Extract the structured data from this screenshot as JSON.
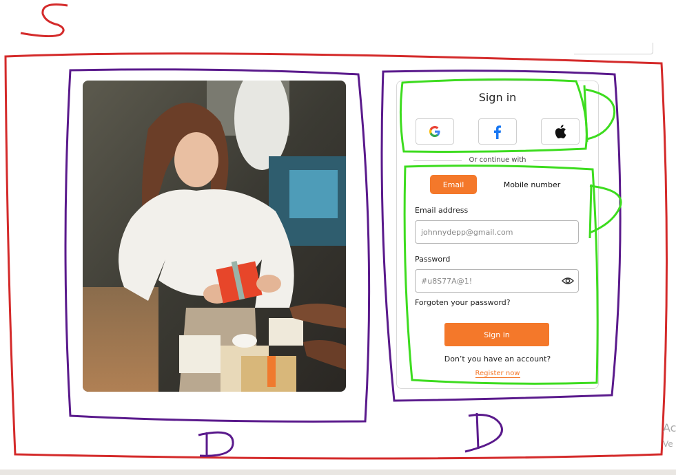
{
  "signin": {
    "title": "Sign in",
    "social": [
      {
        "name": "google-icon"
      },
      {
        "name": "facebook-icon"
      },
      {
        "name": "apple-icon"
      }
    ],
    "divider": "Or continue with",
    "tabs": [
      "Email",
      "Mobile number"
    ],
    "email_label": "Email address",
    "email_placeholder": "johnnydepp@gmail.com",
    "password_label": "Password",
    "password_placeholder": "#u8S77A@1!",
    "forgot": "Forgoten your password?",
    "button": "Sign in",
    "no_account": "Don’t you have an account?",
    "register": "Register now"
  },
  "annotations": {
    "s": "S",
    "d_left": "D",
    "d_right": "D"
  },
  "watermark": {
    "line1": "Ac",
    "line2": "Ve"
  },
  "colors": {
    "accent": "#f4782a",
    "red_mark": "#d42a2a",
    "purple_mark": "#5a1a8c",
    "green_mark": "#3ddc1f"
  }
}
